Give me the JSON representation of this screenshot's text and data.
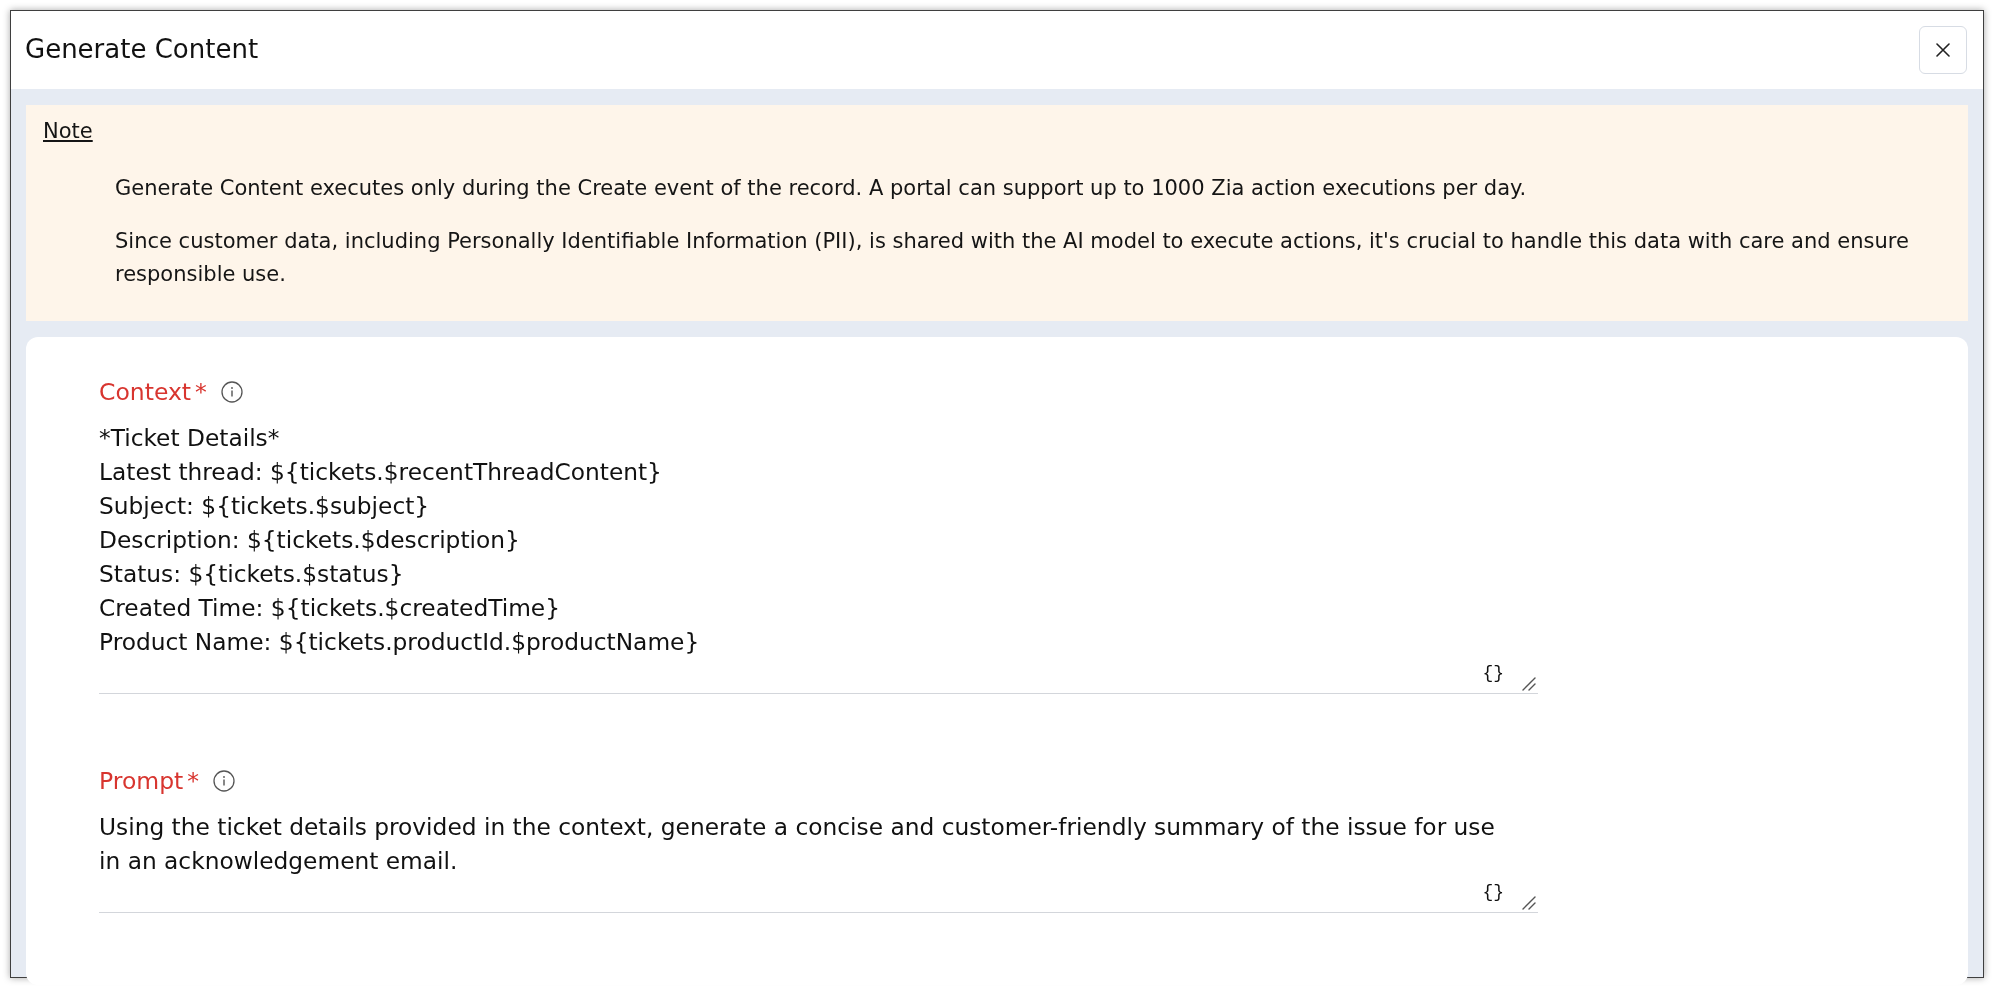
{
  "dialog": {
    "title": "Generate Content"
  },
  "note": {
    "heading": "Note",
    "paragraphs": [
      "Generate Content executes only during the Create event of the record. A portal can support up to 1000 Zia action executions per day.",
      "Since customer data, including Personally Identifiable Information (PII), is shared with the AI model to execute actions, it's crucial to handle this data with care and ensure responsible use."
    ]
  },
  "fields": [
    {
      "label": "Context",
      "required_mark": "*",
      "value": "*Ticket Details*\nLatest thread: ${tickets.$recentThreadContent}\nSubject: ${tickets.$subject}\nDescription: ${tickets.$description}\nStatus: ${tickets.$status}\nCreated Time: ${tickets.$createdTime}\nProduct Name: ${tickets.productId.$productName}",
      "variable_button": "{}"
    },
    {
      "label": "Prompt",
      "required_mark": "*",
      "value": "Using the ticket details provided in the context, generate a concise and customer-friendly summary of the issue for use in an acknowledgement email.",
      "variable_button": "{}"
    }
  ]
}
